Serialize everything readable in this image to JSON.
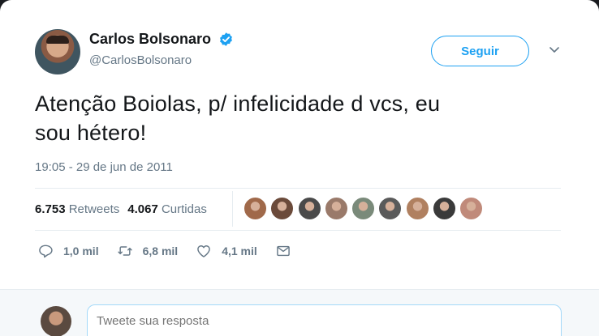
{
  "user": {
    "display_name": "Carlos Bolsonaro",
    "handle": "@CarlosBolsonaro",
    "verified": true
  },
  "follow_button": {
    "label": "Seguir"
  },
  "tweet": {
    "text_line1": "Atenção Boiolas, p/ infelicidade d vcs, eu",
    "text_line2": "sou hétero!",
    "timestamp": "19:05 - 29 de jun de 2011"
  },
  "stats": {
    "retweets_count": "6.753",
    "retweets_label": "Retweets",
    "likes_count": "4.067",
    "likes_label": "Curtidas"
  },
  "likers": [
    {
      "color": "#a0694a"
    },
    {
      "color": "#6b4a3a"
    },
    {
      "color": "#4a4a4a"
    },
    {
      "color": "#9a7a6a"
    },
    {
      "color": "#7a8a7a"
    },
    {
      "color": "#5a5a5a"
    },
    {
      "color": "#b08060"
    },
    {
      "color": "#3a3a3a"
    },
    {
      "color": "#c08a7a"
    }
  ],
  "actions": {
    "reply_count": "1,0 mil",
    "retweet_count": "6,8 mil",
    "like_count": "4,1 mil"
  },
  "reply": {
    "placeholder": "Tweete sua resposta"
  },
  "colors": {
    "accent": "#1da1f2",
    "muted": "#657786",
    "text": "#14171a"
  }
}
